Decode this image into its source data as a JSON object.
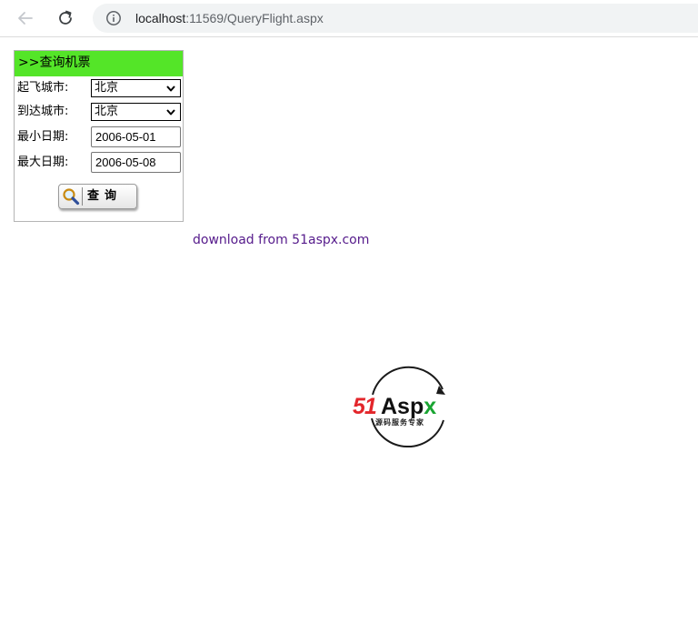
{
  "browser": {
    "url_host": "localhost",
    "url_rest": ":11569/QueryFlight.aspx"
  },
  "panel": {
    "header": ">>查询机票",
    "departure_label": "起飞城市:",
    "departure_value": "北京",
    "arrival_label": "到达城市:",
    "arrival_value": "北京",
    "min_date_label": "最小日期:",
    "min_date_value": "2006-05-01",
    "max_date_label": "最大日期:",
    "max_date_value": "2006-05-08",
    "search_button_label": "查询",
    "header_color": "#54e528"
  },
  "download_link": "download from 51aspx.com",
  "logo": {
    "brand_number": "51",
    "brand_word": "Asp",
    "brand_letter": "x",
    "tagline": "源码服务专家",
    "colors": {
      "number": "#e3262b",
      "letter": "#1aa532"
    }
  },
  "icons": {
    "back": "arrow-left-icon",
    "reload": "reload-icon",
    "site_info": "info-icon",
    "search": "magnifier-icon",
    "dropdown": "chevron-down-icon"
  }
}
